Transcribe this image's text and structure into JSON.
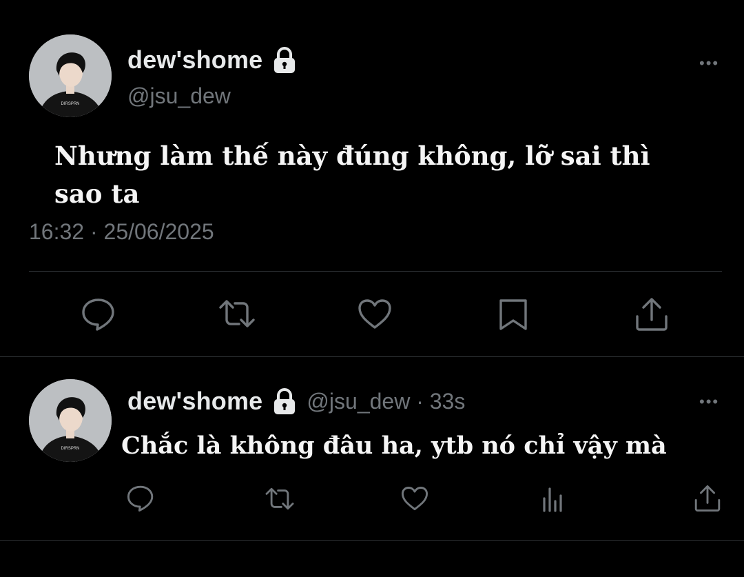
{
  "main_tweet": {
    "display_name": "dew'shome",
    "handle": "@jsu_dew",
    "text_line1": "Nhưng làm thế này đúng không, lỡ sai thì",
    "text_line2": "sao ta",
    "timestamp": "16:32 · 25/06/2025",
    "more_label": "•••",
    "actions": [
      "reply",
      "retweet",
      "like",
      "bookmark",
      "share"
    ]
  },
  "reply_tweet": {
    "display_name": "dew'shome",
    "handle_time": "@jsu_dew · 33s",
    "text": "Chắc là không đâu ha, ytb nó chỉ vậy mà",
    "more_label": "•••",
    "actions": [
      "reply",
      "retweet",
      "like",
      "views",
      "share"
    ]
  },
  "colors": {
    "background": "#000000",
    "primary_text": "#e7e9ea",
    "secondary_text": "#71767b",
    "divider": "#2f3336"
  }
}
